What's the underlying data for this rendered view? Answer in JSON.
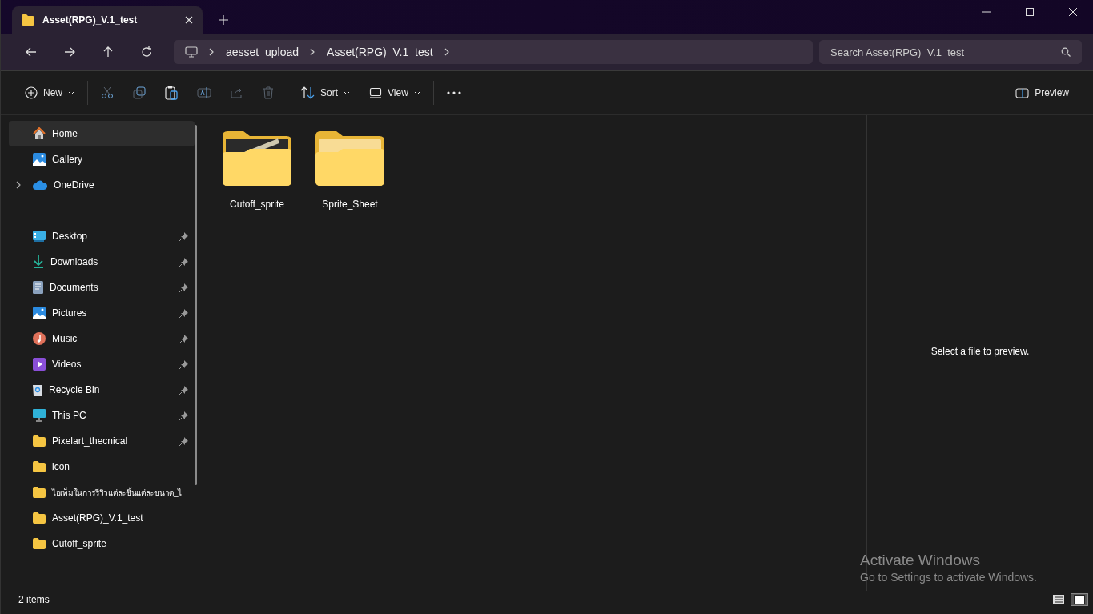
{
  "tabs": [
    {
      "title": "Asset(RPG)_V.1_test",
      "selected": true
    }
  ],
  "address": {
    "crumbs": [
      "aesset_upload",
      "Asset(RPG)_V.1_test"
    ]
  },
  "search": {
    "placeholder": "Search Asset(RPG)_V.1_test"
  },
  "toolbar": [
    {
      "kind": "new",
      "label": "New",
      "disabled": false
    },
    {
      "kind": "cut",
      "disabled": true
    },
    {
      "kind": "copy",
      "disabled": true
    },
    {
      "kind": "paste",
      "disabled": false
    },
    {
      "kind": "rename",
      "disabled": true
    },
    {
      "kind": "share",
      "disabled": true
    },
    {
      "kind": "delete",
      "disabled": true
    },
    {
      "kind": "sort",
      "label": "Sort",
      "disabled": false
    },
    {
      "kind": "view",
      "label": "View",
      "disabled": false
    },
    {
      "kind": "more",
      "disabled": false
    }
  ],
  "preview_button": {
    "label": "Preview"
  },
  "sidebar": {
    "groups": [
      [
        {
          "label": "Home",
          "kind": "home",
          "selected": true,
          "pinned": false,
          "expandable": false
        },
        {
          "label": "Gallery",
          "kind": "gallery",
          "selected": false,
          "pinned": false,
          "expandable": false
        },
        {
          "label": "OneDrive",
          "kind": "cloud",
          "selected": false,
          "pinned": false,
          "expandable": true
        }
      ],
      [
        {
          "label": "Desktop",
          "kind": "desktop",
          "selected": false,
          "pinned": true,
          "expandable": false
        },
        {
          "label": "Downloads",
          "kind": "download",
          "selected": false,
          "pinned": true,
          "expandable": false
        },
        {
          "label": "Documents",
          "kind": "document",
          "selected": false,
          "pinned": true,
          "expandable": false
        },
        {
          "label": "Pictures",
          "kind": "gallery",
          "selected": false,
          "pinned": true,
          "expandable": false
        },
        {
          "label": "Music",
          "kind": "music",
          "selected": false,
          "pinned": true,
          "expandable": false
        },
        {
          "label": "Videos",
          "kind": "video",
          "selected": false,
          "pinned": true,
          "expandable": false
        },
        {
          "label": "Recycle Bin",
          "kind": "bin",
          "selected": false,
          "pinned": true,
          "expandable": false
        },
        {
          "label": "This PC",
          "kind": "monitor",
          "selected": false,
          "pinned": true,
          "expandable": false
        },
        {
          "label": "Pixelart_thecnical",
          "kind": "folder",
          "selected": false,
          "pinned": true,
          "expandable": false
        },
        {
          "label": "icon",
          "kind": "folder",
          "selected": false,
          "pinned": false,
          "expandable": false
        },
        {
          "label": "ไอเท็มในการรีวิวแต่ละชิ้นแต่ละขนาด_ไ",
          "kind": "folder",
          "selected": false,
          "pinned": false,
          "expandable": false
        },
        {
          "label": "Asset(RPG)_V.1_test",
          "kind": "folder",
          "selected": false,
          "pinned": false,
          "expandable": false
        },
        {
          "label": "Cutoff_sprite",
          "kind": "folder",
          "selected": false,
          "pinned": false,
          "expandable": false
        }
      ]
    ]
  },
  "files": [
    {
      "name": "Cutoff_sprite",
      "kind": "thumbnail"
    },
    {
      "name": "Sprite_Sheet",
      "kind": "plain"
    }
  ],
  "preview_pane": {
    "message": "Select a file to preview."
  },
  "status_bar": {
    "count": "2 items",
    "views": [
      {
        "kind": "details",
        "selected": false
      },
      {
        "kind": "tiles",
        "selected": true
      }
    ]
  },
  "activation": {
    "title": "Activate Windows",
    "message": "Go to Settings to activate Windows."
  }
}
